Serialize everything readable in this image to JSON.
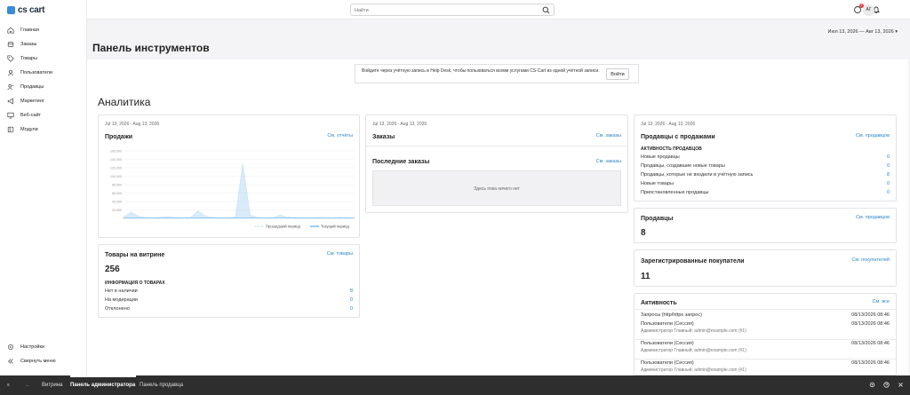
{
  "brand": {
    "name": "cs cart"
  },
  "sidebar": {
    "items": [
      {
        "label": "Главная",
        "icon": "home-icon"
      },
      {
        "label": "Заказы",
        "icon": "orders-icon"
      },
      {
        "label": "Товары",
        "icon": "tag-icon"
      },
      {
        "label": "Пользователи",
        "icon": "users-icon"
      },
      {
        "label": "Продавцы",
        "icon": "vendors-icon"
      },
      {
        "label": "Маркетинг",
        "icon": "marketing-icon"
      },
      {
        "label": "Веб-сайт",
        "icon": "website-icon"
      },
      {
        "label": "Модули",
        "icon": "modules-icon"
      }
    ],
    "settings_label": "Настройки",
    "collapse_label": "Свернуть меню"
  },
  "topbar": {
    "search_placeholder": "Найти",
    "notifications_count": "2",
    "avatar_initials": "АГ"
  },
  "page": {
    "title": "Панель инструментов",
    "date_range": "Июл 13, 2026 — Авг 13, 2026 ▾",
    "notice_text": "Войдите через учётную запись в Help Desk, чтобы пользоваться всеми услугами CS-Cart из одной учётной записи.",
    "notice_button": "Войти",
    "analytics_title": "Аналитика"
  },
  "sales_card": {
    "date": "Jul 13, 2026 - Aug 13, 2026",
    "title": "Продажи",
    "link": "См. отчёты",
    "legend_prev": "Прошедший период",
    "legend_curr": "Текущий период"
  },
  "chart_data": {
    "type": "area",
    "ylim": [
      0,
      160000
    ],
    "yticks": [
      "160,000",
      "140,000",
      "120,000",
      "100,000",
      "80,000",
      "60,000",
      "40,000",
      "20,000"
    ],
    "series": [
      {
        "name": "Прошедший период",
        "values": [
          2000,
          15000,
          5000,
          2000,
          1000,
          3000,
          4000,
          2000,
          1500,
          2000,
          18000,
          5000,
          2000,
          1000,
          1500,
          3000,
          130000,
          8000,
          2000,
          1000,
          1500,
          8000,
          3000,
          2000,
          1500,
          1000,
          2000,
          1500,
          1000,
          2000,
          1500,
          1000
        ]
      },
      {
        "name": "Текущий период",
        "values": [
          500,
          500,
          400,
          400,
          400,
          400,
          400,
          400,
          500,
          400,
          400,
          400,
          400,
          400,
          400,
          400,
          400,
          400,
          400,
          400,
          400,
          400,
          400,
          400,
          400,
          400,
          400,
          400,
          400,
          400,
          400,
          400
        ]
      }
    ],
    "colors": {
      "previous": "#b9dbf3",
      "current": "#5aa9e6"
    }
  },
  "products_card": {
    "title": "Товары на витрине",
    "link": "См. товары",
    "count": "256",
    "info_header": "ИНФОРМАЦИЯ О ТОВАРАХ",
    "rows": [
      {
        "label": "Нет в наличии",
        "value": "8"
      },
      {
        "label": "На модерации",
        "value": "0"
      },
      {
        "label": "Отклонено",
        "value": "0"
      }
    ]
  },
  "orders_card": {
    "date": "Jul 13, 2026 - Aug 13, 2026",
    "title": "Заказы",
    "link": "См. заказы",
    "recent_title": "Последние заказы",
    "recent_link": "См. заказы",
    "empty_text": "Здесь пока ничего нет"
  },
  "vendors_sales_card": {
    "date": "Jul 13, 2026 - Aug 13, 2026",
    "title": "Продавцы с продажами",
    "link": "См. продавцов",
    "activity_header": "АКТИВНОСТЬ ПРОДАВЦОВ",
    "rows": [
      {
        "label": "Новые продавцы",
        "value": "0"
      },
      {
        "label": "Продавцы, создавшие новые товары",
        "value": "0"
      },
      {
        "label": "Продавцы, которые не входили в учётную запись",
        "value": "8"
      },
      {
        "label": "Новые товары",
        "value": "0"
      },
      {
        "label": "Приостановленные продавцы",
        "value": "0"
      }
    ]
  },
  "vendors_card": {
    "title": "Продавцы",
    "link": "См. продавцов",
    "count": "8"
  },
  "customers_card": {
    "title": "Зарегистрированные покупатели",
    "link": "См. покупателей",
    "count": "11"
  },
  "activity_card": {
    "title": "Активность",
    "link": "См. все",
    "rows": [
      {
        "label": "Запросы (http/https запрос)",
        "time": "08/13/2026 08:46",
        "sub": ""
      },
      {
        "label": "Пользователи (Сессия)",
        "time": "08/13/2026 08:46",
        "sub": "Администратор Главный; admin@example.com (#1)"
      },
      {
        "label": "Пользователи (Сессия)",
        "time": "08/13/2026 08:46",
        "sub": "Администратор Главный; admin@example.com (#1)"
      },
      {
        "label": "Пользователи (Сессия)",
        "time": "08/13/2026 08:46",
        "sub": "Администратор Главный; admin@example.com (#1)"
      }
    ]
  },
  "footer": {
    "storefront": "Витрина",
    "admin_panel": "Панель администратора",
    "vendor_panel": "Панель продавца"
  }
}
